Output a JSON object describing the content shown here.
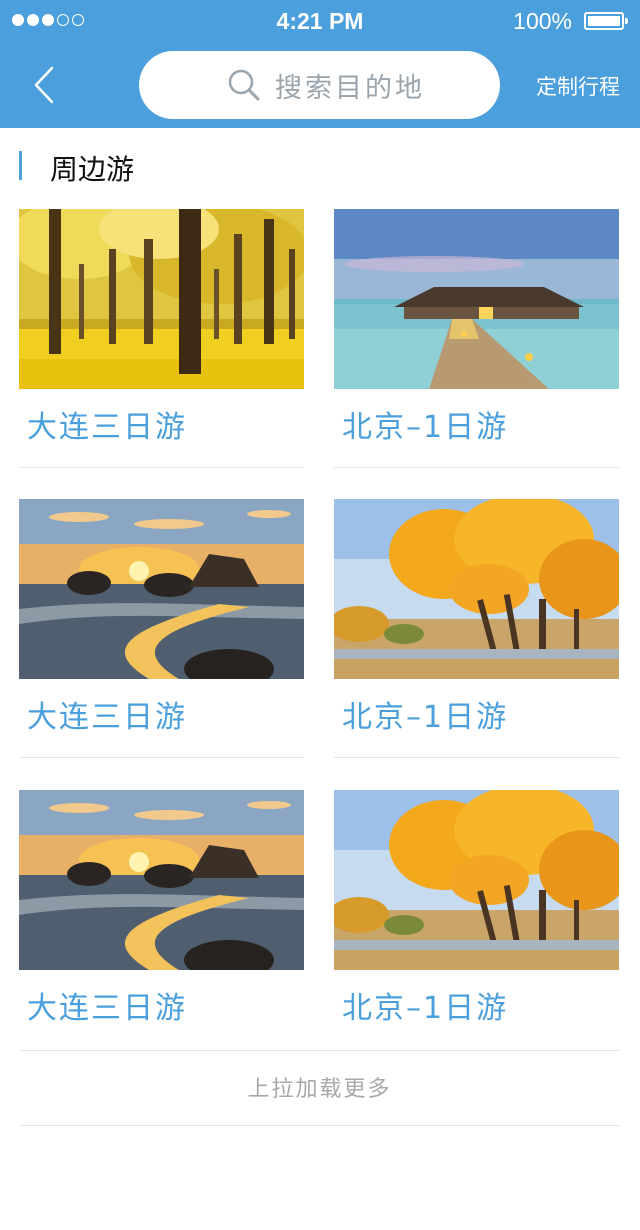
{
  "status_bar": {
    "time": "4:21 PM",
    "battery": "100%",
    "signal_bars_filled": 3,
    "signal_bars_total": 5
  },
  "header": {
    "back_icon": "chevron-left-icon",
    "search": {
      "icon": "search-icon",
      "placeholder": "搜索目的地"
    },
    "custom_trip": "定制行程"
  },
  "section": {
    "title": "周边游"
  },
  "cards": [
    {
      "label": "大连三日游",
      "image": "golden-ginkgo-forest"
    },
    {
      "label": "北京–1日游",
      "image": "overwater-villa-pier"
    },
    {
      "label": "大连三日游",
      "image": "sunset-beach-rocks"
    },
    {
      "label": "北京–1日游",
      "image": "autumn-poplar-trees"
    },
    {
      "label": "大连三日游",
      "image": "sunset-beach-rocks"
    },
    {
      "label": "北京–1日游",
      "image": "autumn-poplar-trees"
    }
  ],
  "load_more": "上拉加载更多",
  "colors": {
    "accent": "#4a9fdc",
    "divider": "#e4e4e4",
    "muted_text": "#a8a8a8"
  }
}
